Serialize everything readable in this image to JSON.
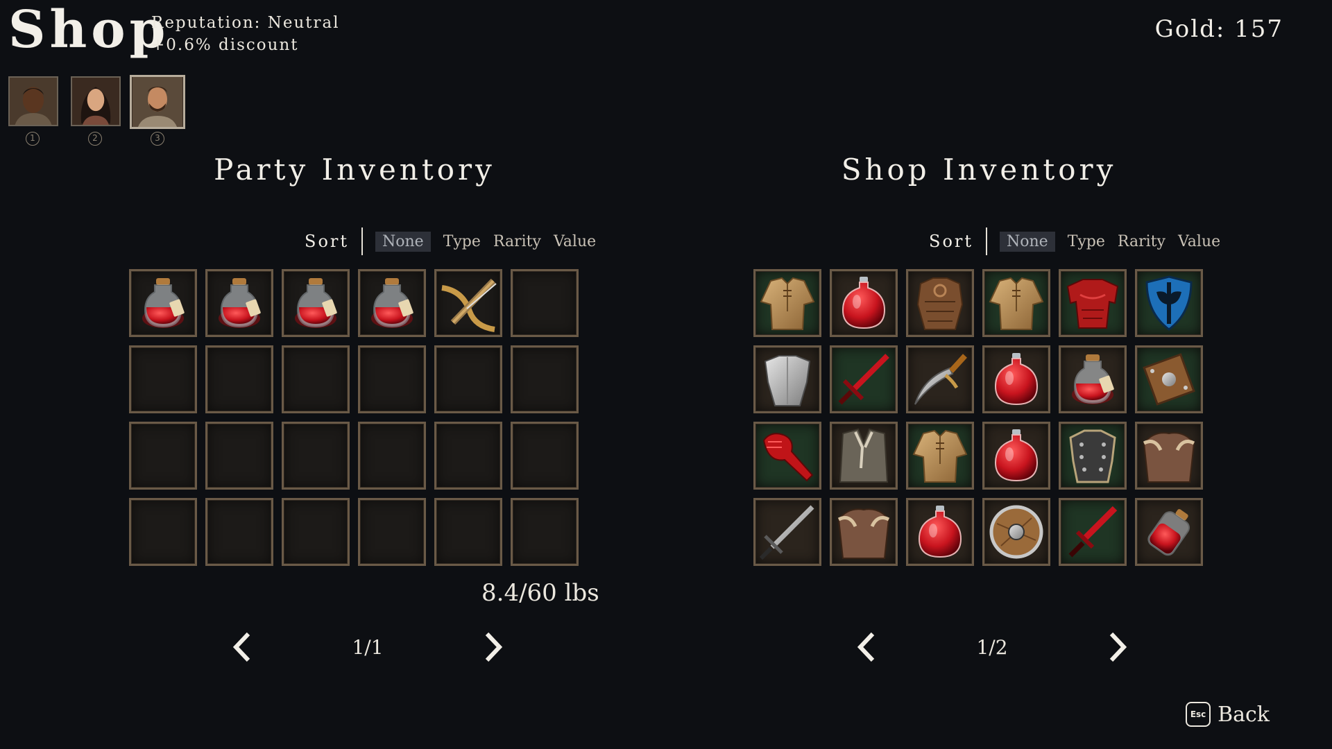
{
  "header": {
    "title": "Shop",
    "reputation": "Reputation: Neutral",
    "discount": "+0.6% discount",
    "gold": "Gold: 157"
  },
  "party": {
    "members": [
      {
        "number": "1",
        "portrait": "dark-skinned-man-portrait",
        "selected": false
      },
      {
        "number": "2",
        "portrait": "dark-haired-woman-portrait",
        "selected": false
      },
      {
        "number": "3",
        "portrait": "bearded-man-portrait",
        "selected": true
      }
    ]
  },
  "party_inventory": {
    "title": "Party Inventory",
    "sort_label": "Sort",
    "sort_options": [
      "None",
      "Type",
      "Rarity",
      "Value"
    ],
    "active_sort": "None",
    "items": [
      "health-potion-flask-icon",
      "health-potion-flask-icon",
      "health-potion-flask-icon",
      "health-potion-flask-icon",
      "crossbow-icon"
    ],
    "weight": "8.4/60 lbs",
    "page": "1/1"
  },
  "shop_inventory": {
    "title": "Shop Inventory",
    "sort_label": "Sort",
    "sort_options": [
      "None",
      "Type",
      "Rarity",
      "Value"
    ],
    "active_sort": "None",
    "items": [
      "leather-tunic-icon",
      "round-red-potion-icon",
      "leather-armor-icon",
      "leather-tunic-icon",
      "red-plate-armor-icon",
      "blue-kite-shield-icon",
      "steel-breastplate-icon",
      "red-sword-icon",
      "curved-dagger-icon",
      "round-red-potion-icon",
      "health-potion-flask-icon",
      "wooden-square-shield-icon",
      "red-gauntlet-icon",
      "fur-vest-icon",
      "leather-tunic-icon",
      "round-red-potion-icon",
      "studded-armor-icon",
      "leather-pauldron-armor-icon",
      "steel-sword-icon",
      "leather-pauldron-armor-icon",
      "round-red-potion-icon",
      "round-wooden-shield-icon",
      "red-shortsword-icon",
      "red-potion-jar-icon"
    ],
    "page": "1/2"
  },
  "footer": {
    "back_key": "Esc",
    "back_label": "Back"
  },
  "colors": {
    "background": "#0d0f13",
    "slot_border": "#6a5a47",
    "rare_slot_bg": "#1f3524",
    "potion_red": "#c8141e"
  }
}
